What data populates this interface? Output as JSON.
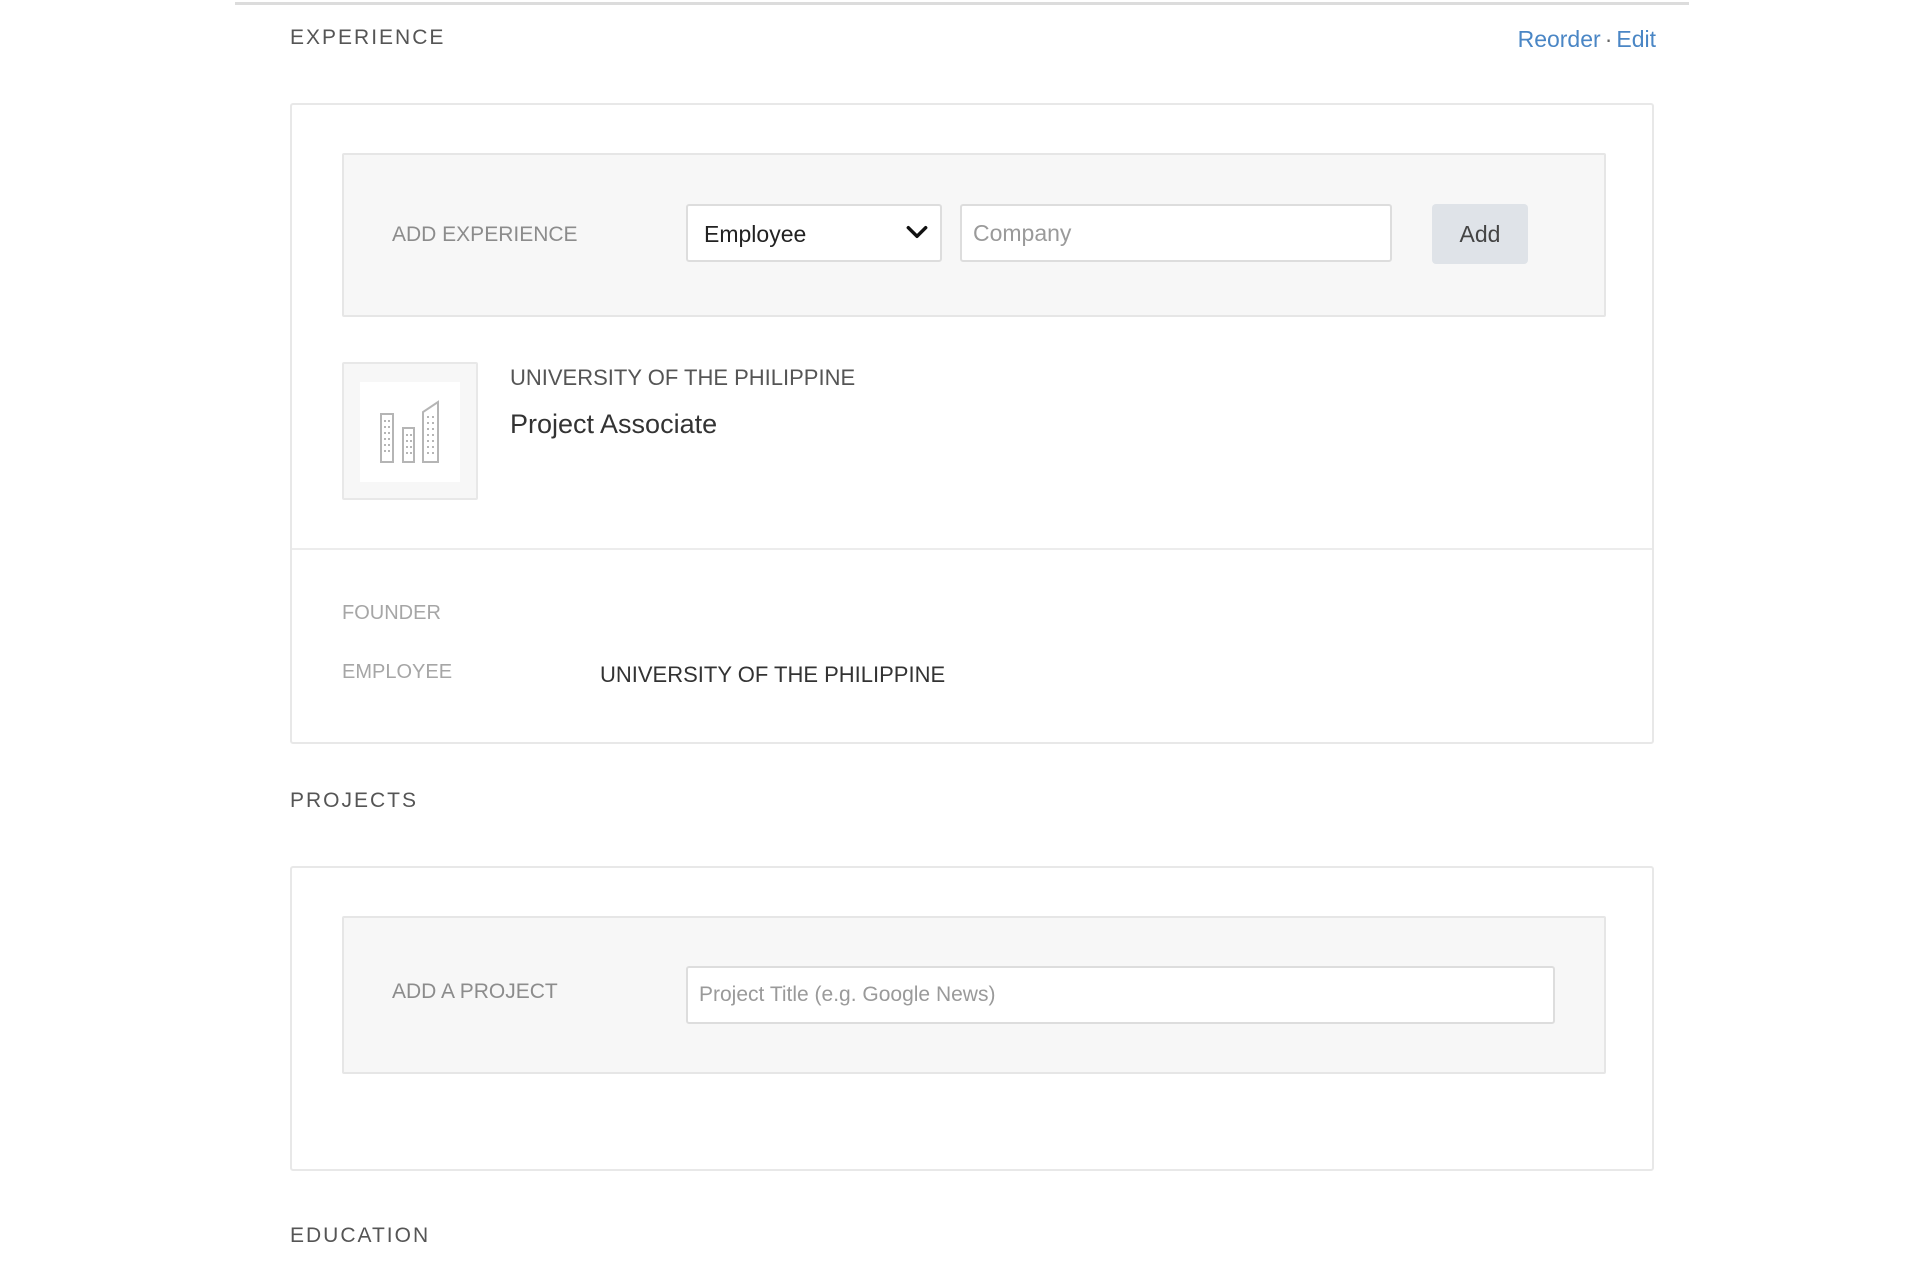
{
  "experience": {
    "heading": "EXPERIENCE",
    "actions": {
      "reorder": "Reorder",
      "separator": "·",
      "edit": "Edit"
    },
    "add_form": {
      "label": "ADD EXPERIENCE",
      "role_select_value": "Employee",
      "company_placeholder": "Company",
      "add_button": "Add"
    },
    "entry": {
      "logo_icon": "office-buildings-icon",
      "company": "UNIVERSITY OF THE PHILIPPINE",
      "title": "Project Associate"
    },
    "summary": [
      {
        "label": "FOUNDER",
        "value": ""
      },
      {
        "label": "EMPLOYEE",
        "value": "UNIVERSITY OF THE PHILIPPINE"
      }
    ]
  },
  "projects": {
    "heading": "PROJECTS",
    "add_form": {
      "label": "ADD A PROJECT",
      "title_placeholder": "Project Title (e.g. Google News)"
    }
  },
  "education": {
    "heading": "EDUCATION"
  },
  "colors": {
    "link": "#4a86c5",
    "add_button_bg": "#dfe3e8",
    "form_bg": "#f7f7f7"
  }
}
